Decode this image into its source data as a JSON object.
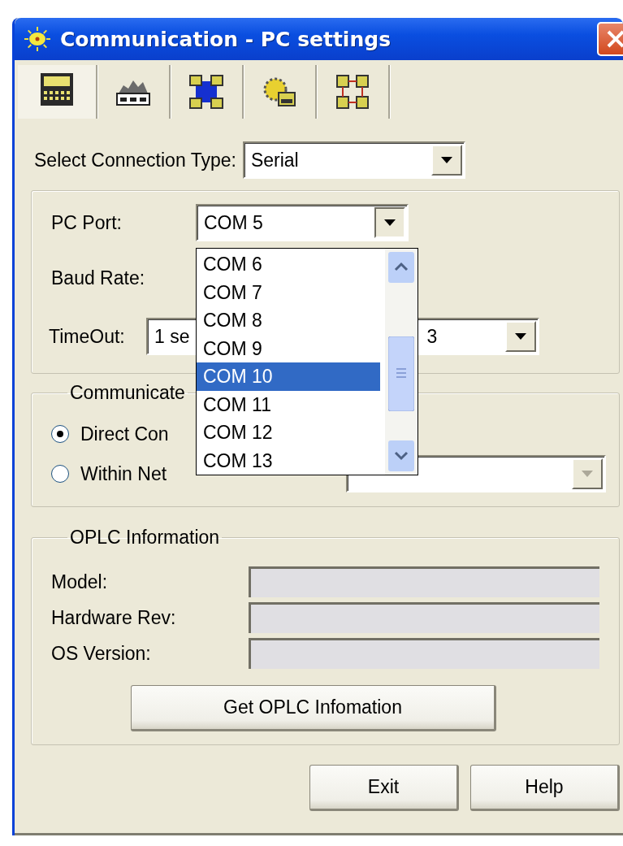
{
  "window": {
    "title": "Communication - PC settings"
  },
  "tabs": [
    {
      "selected": true
    },
    {
      "selected": false
    },
    {
      "selected": false
    },
    {
      "selected": false
    },
    {
      "selected": false
    }
  ],
  "connection_type": {
    "label": "Select Connection Type:",
    "value": "Serial"
  },
  "serial_group": {
    "pc_port": {
      "label": "PC Port:",
      "value": "COM 5",
      "expanded": true,
      "options": [
        {
          "label": "COM 6",
          "selected": false
        },
        {
          "label": "COM 7",
          "selected": false
        },
        {
          "label": "COM 8",
          "selected": false
        },
        {
          "label": "COM 9",
          "selected": false
        },
        {
          "label": "COM 10",
          "selected": true
        },
        {
          "label": "COM 11",
          "selected": false
        },
        {
          "label": "COM 12",
          "selected": false
        },
        {
          "label": "COM 13",
          "selected": false
        }
      ]
    },
    "baud_rate": {
      "label": "Baud Rate:"
    },
    "timeout": {
      "label": "TimeOut:",
      "value": "1 se",
      "value_2": "3"
    }
  },
  "communicate_group": {
    "title": "Communicate",
    "options": [
      {
        "label": "Direct Con",
        "selected": true
      },
      {
        "label": "Within Net",
        "selected": false
      }
    ],
    "network_combo": {
      "disabled": true
    }
  },
  "oplc_group": {
    "title": "OPLC Information",
    "fields": [
      {
        "label": "Model:"
      },
      {
        "label": "Hardware Rev:"
      },
      {
        "label": "OS Version:"
      }
    ],
    "button": "Get OPLC Infomation"
  },
  "buttons": [
    "Exit",
    "Help"
  ]
}
